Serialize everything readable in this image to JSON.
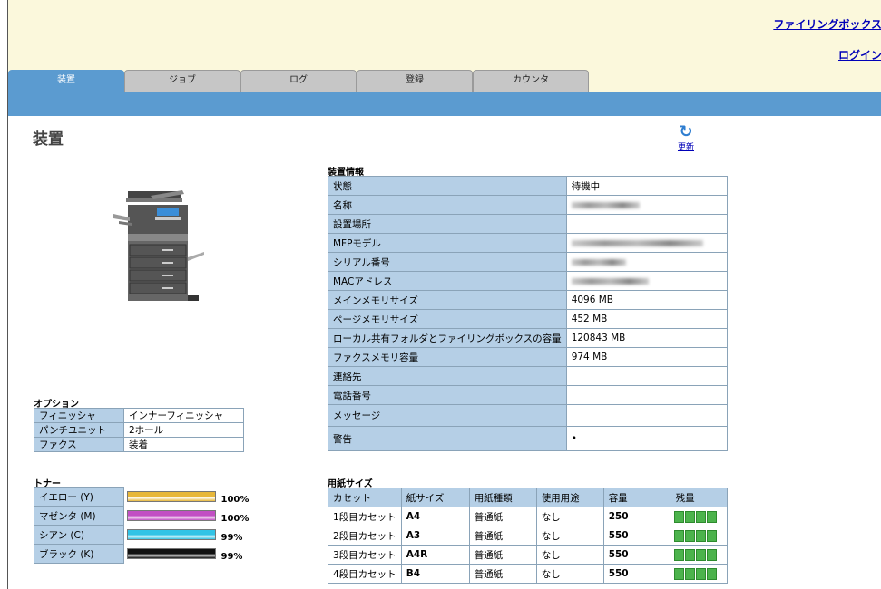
{
  "header": {
    "link_filebox": "ファイリングボックス",
    "link_login": "ログイン"
  },
  "tabs": [
    {
      "label": "装置",
      "active": true
    },
    {
      "label": "ジョブ"
    },
    {
      "label": "ログ"
    },
    {
      "label": "登録"
    },
    {
      "label": "カウンタ"
    }
  ],
  "page": {
    "title": "装置",
    "refresh_label": "更新",
    "refresh_icon": "refresh-icon"
  },
  "options": {
    "title": "オプション",
    "rows": [
      {
        "key": "フィニッシャ",
        "value": "インナーフィニッシャ"
      },
      {
        "key": "パンチユニット",
        "value": "2ホール"
      },
      {
        "key": "ファクス",
        "value": "装着"
      }
    ]
  },
  "toner": {
    "title": "トナー",
    "rows": [
      {
        "label": "イエロー (Y)",
        "percent": "100%",
        "color": "#e7b73a"
      },
      {
        "label": "マゼンタ (M)",
        "percent": "100%",
        "color": "#c24fc4"
      },
      {
        "label": "シアン (C)",
        "percent": "99%",
        "color": "#31c3e6"
      },
      {
        "label": "ブラック (K)",
        "percent": "99%",
        "color": "#111111"
      }
    ]
  },
  "device_info": {
    "title": "装置情報",
    "rows": [
      {
        "key": "状態",
        "value": "待機中"
      },
      {
        "key": "名称",
        "value": ""
      },
      {
        "key": "設置場所",
        "value": ""
      },
      {
        "key": "MFPモデル",
        "value": ""
      },
      {
        "key": "シリアル番号",
        "value": ""
      },
      {
        "key": "MACアドレス",
        "value": ""
      },
      {
        "key": "メインメモリサイズ",
        "value": "4096 MB"
      },
      {
        "key": "ページメモリサイズ",
        "value": "452 MB"
      },
      {
        "key": "ローカル共有フォルダとファイリングボックスの容量",
        "value": "120843 MB"
      },
      {
        "key": "ファクスメモリ容量",
        "value": "974 MB"
      },
      {
        "key": "連絡先",
        "value": ""
      },
      {
        "key": "電話番号",
        "value": ""
      },
      {
        "key": "メッセージ",
        "value": ""
      },
      {
        "key": "警告",
        "value": "•"
      }
    ]
  },
  "paper": {
    "title": "用紙サイズ",
    "headers": [
      "カセット",
      "紙サイズ",
      "用紙種類",
      "使用用途",
      "容量",
      "残量"
    ],
    "rows": [
      {
        "cassette": "1段目カセット",
        "size": "A4",
        "type": "普通紙",
        "use": "なし",
        "capacity": "250"
      },
      {
        "cassette": "2段目カセット",
        "size": "A3",
        "type": "普通紙",
        "use": "なし",
        "capacity": "550"
      },
      {
        "cassette": "3段目カセット",
        "size": "A4R",
        "type": "普通紙",
        "use": "なし",
        "capacity": "550"
      },
      {
        "cassette": "4段目カセット",
        "size": "B4",
        "type": "普通紙",
        "use": "なし",
        "capacity": "550"
      }
    ]
  }
}
